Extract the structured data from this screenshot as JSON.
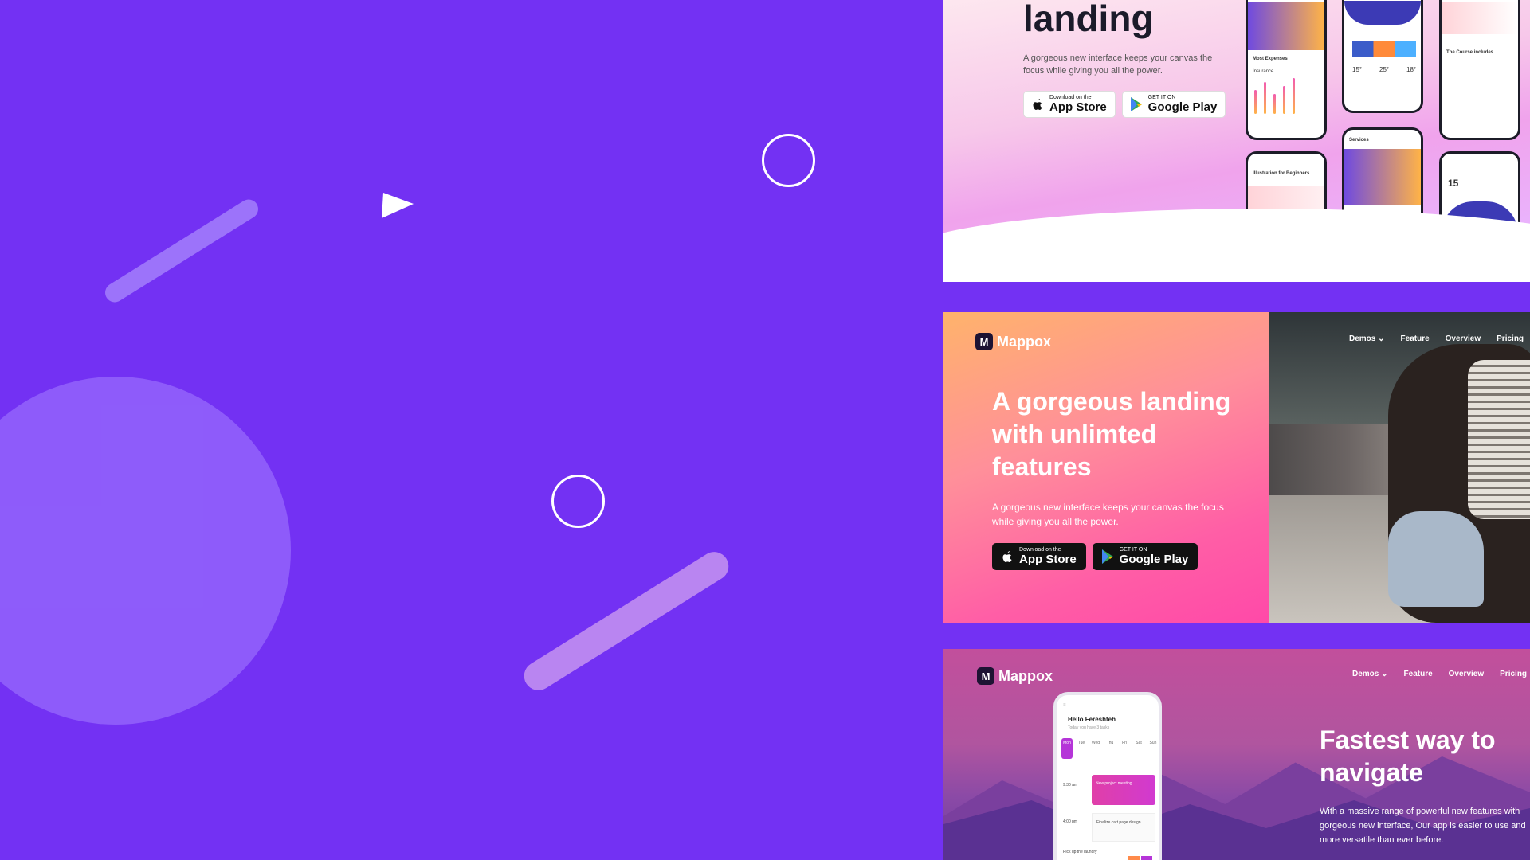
{
  "panel_top": {
    "heading": "landing",
    "description": "A gorgeous new interface keeps your canvas the focus while giving you all the power.",
    "app_store": {
      "small": "Download on the",
      "big": "App Store"
    },
    "google_play": {
      "small": "GET IT ON",
      "big": "Google Play"
    },
    "phone_labels": {
      "most_expenses": "Most Expenses",
      "insurance": "Insurance",
      "course_includes": "The Course includes",
      "services": "Services",
      "illustration": "Illustration for Beginners",
      "temps": [
        "15°",
        "25°",
        "18°"
      ],
      "big_temp": "15"
    }
  },
  "panel_middle": {
    "brand": "Mappox",
    "nav": [
      "Demos",
      "Feature",
      "Overview",
      "Pricing"
    ],
    "heading": "A gorgeous landing with unlimted features",
    "description": "A gorgeous new interface keeps your canvas the focus while giving you all the power.",
    "app_store": {
      "small": "Download on the",
      "big": "App Store"
    },
    "google_play": {
      "small": "GET IT ON",
      "big": "Google Play"
    }
  },
  "panel_bottom": {
    "brand": "Mappox",
    "nav": [
      "Demos",
      "Feature",
      "Overview",
      "Pricing"
    ],
    "heading": "Fastest way to navigate",
    "description_lines": [
      "With a massive range of powerful new features with",
      "gorgeous new interface, Our app is easier to use and",
      "more versatile than ever before."
    ],
    "app": {
      "greeting": "Hello Fereshteh",
      "subtitle": "Today you have 3 tasks",
      "days": [
        "Mon",
        "Tue",
        "Wed",
        "Thu",
        "Fri",
        "Sat",
        "Sun"
      ],
      "time_1": "9:30 am",
      "task_1": "New project meeting",
      "time_2": "4:00 pm",
      "task_2": "Finalize cart page design",
      "task_3": "Pick up the laundry"
    }
  },
  "colors": {
    "background": "#7331f3",
    "accent_pink": "#ff49a8",
    "accent_orange": "#ffb36b"
  }
}
